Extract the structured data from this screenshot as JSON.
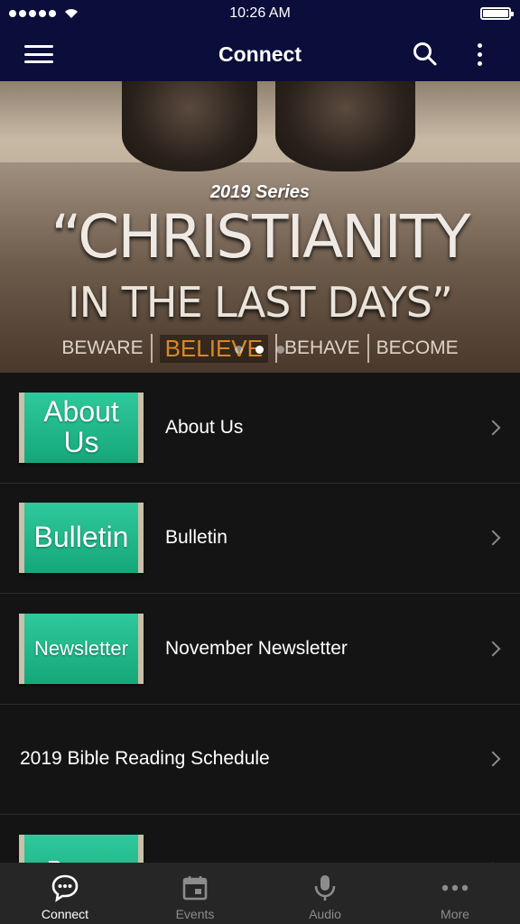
{
  "status_bar": {
    "time": "10:26 AM"
  },
  "nav": {
    "title": "Connect"
  },
  "banner": {
    "series": "2019 Series",
    "title_line1": "“CHRISTIANITY",
    "title_line2": "IN THE LAST DAYS”",
    "words": [
      "BEWARE",
      "BELIEVE",
      "BEHAVE",
      "BECOME"
    ],
    "active_word": "BELIEVE",
    "pager": {
      "count": 3,
      "current": 1
    }
  },
  "list": [
    {
      "thumb_text": "About Us",
      "label": "About Us"
    },
    {
      "thumb_text": "Bulletin",
      "label": "Bulletin"
    },
    {
      "thumb_text": "Newsletter",
      "label": "November Newsletter"
    },
    {
      "thumb_text": "",
      "label": "2019 Bible Reading Schedule"
    },
    {
      "thumb_text": "Prayer",
      "label": ""
    }
  ],
  "tabs": [
    {
      "label": "Connect",
      "icon": "chat-bubble-icon",
      "active": true
    },
    {
      "label": "Events",
      "icon": "calendar-icon",
      "active": false
    },
    {
      "label": "Audio",
      "icon": "microphone-icon",
      "active": false
    },
    {
      "label": "More",
      "icon": "more-dots-icon",
      "active": false
    }
  ],
  "colors": {
    "nav_bg": "#0b0e3a",
    "thumb_green": "#1fb886",
    "active_word": "#d88727",
    "tab_bg": "#262626"
  }
}
